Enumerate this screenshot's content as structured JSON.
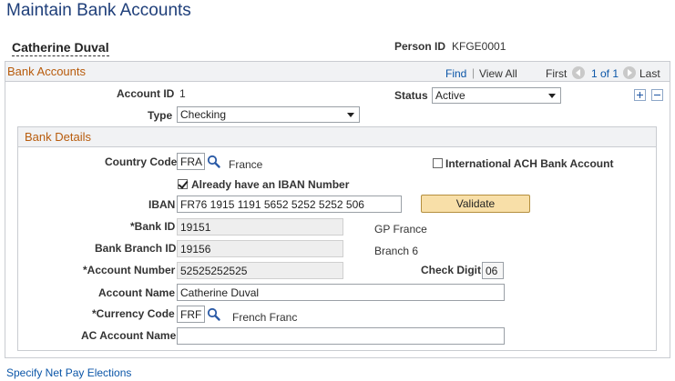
{
  "page": {
    "title": "Maintain Bank Accounts"
  },
  "person": {
    "name": "Catherine Duval",
    "id_label": "Person ID",
    "id_value": "KFGE0001"
  },
  "bank_accounts": {
    "title": "Bank Accounts",
    "nav": {
      "find": "Find",
      "separator": "|",
      "view_all": "View All",
      "first": "First",
      "range": "1 of 1",
      "last": "Last"
    },
    "account_id_label": "Account ID",
    "account_id_value": "1",
    "status_label": "Status",
    "status_value": "Active",
    "type_label": "Type",
    "type_value": "Checking"
  },
  "bank_details": {
    "title": "Bank Details",
    "country_code_label": "Country Code",
    "country_code_value": "FRA",
    "country_name": "France",
    "intl_ach_label": "International ACH Bank Account",
    "intl_ach_checked": false,
    "iban_checkbox_label": "Already have an IBAN Number",
    "iban_checkbox_checked": true,
    "iban_label": "IBAN",
    "iban_value": "FR76 1915 1191 5652 5252 5252 506",
    "validate_label": "Validate",
    "bank_id_label": "*Bank ID",
    "bank_id_value": "19151",
    "bank_name": "GP France",
    "branch_id_label": "Bank Branch ID",
    "branch_id_value": "19156",
    "branch_name": "Branch 6",
    "account_number_label": "*Account Number",
    "account_number_value": "52525252525",
    "check_digit_label": "Check Digit",
    "check_digit_value": "06",
    "account_name_label": "Account Name",
    "account_name_value": "Catherine Duval",
    "currency_code_label": "*Currency Code",
    "currency_code_value": "FRF",
    "currency_name": "French Franc",
    "ac_account_name_label": "AC Account Name",
    "ac_account_name_value": ""
  },
  "footer": {
    "link": "Specify Net Pay Elections"
  },
  "colors": {
    "title": "#1f3f7a",
    "section_title": "#b85c0d",
    "link": "#0b56a8",
    "button": "#f8dfa8"
  }
}
